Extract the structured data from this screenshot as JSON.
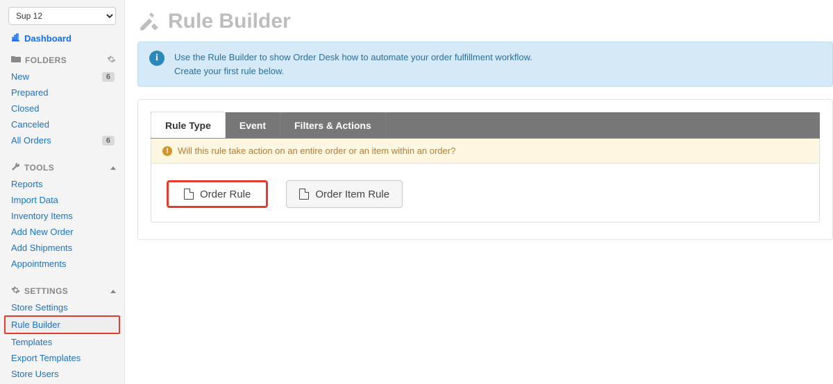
{
  "store_selector": {
    "value": "Sup 12"
  },
  "dashboard": {
    "label": "Dashboard"
  },
  "folders": {
    "header": "FOLDERS",
    "items": [
      {
        "label": "New",
        "count": "6"
      },
      {
        "label": "Prepared",
        "count": null
      },
      {
        "label": "Closed",
        "count": null
      },
      {
        "label": "Canceled",
        "count": null
      },
      {
        "label": "All Orders",
        "count": "6"
      }
    ]
  },
  "tools": {
    "header": "TOOLS",
    "items": [
      {
        "label": "Reports"
      },
      {
        "label": "Import Data"
      },
      {
        "label": "Inventory Items"
      },
      {
        "label": "Add New Order"
      },
      {
        "label": "Add Shipments"
      },
      {
        "label": "Appointments"
      }
    ]
  },
  "settings": {
    "header": "SETTINGS",
    "items": [
      {
        "label": "Store Settings"
      },
      {
        "label": "Rule Builder",
        "active": true
      },
      {
        "label": "Templates"
      },
      {
        "label": "Export Templates"
      },
      {
        "label": "Store Users"
      }
    ]
  },
  "page": {
    "title": "Rule Builder"
  },
  "alert": {
    "line1": "Use the Rule Builder to show Order Desk how to automate your order fulfillment workflow.",
    "line2": "Create your first rule below."
  },
  "tabs": [
    {
      "label": "Rule Type",
      "active": true
    },
    {
      "label": "Event",
      "active": false
    },
    {
      "label": "Filters & Actions",
      "active": false
    }
  ],
  "notice": {
    "text": "Will this rule take action on an entire order or an item within an order?"
  },
  "rule_buttons": {
    "order_rule": "Order Rule",
    "order_item_rule": "Order Item Rule"
  }
}
